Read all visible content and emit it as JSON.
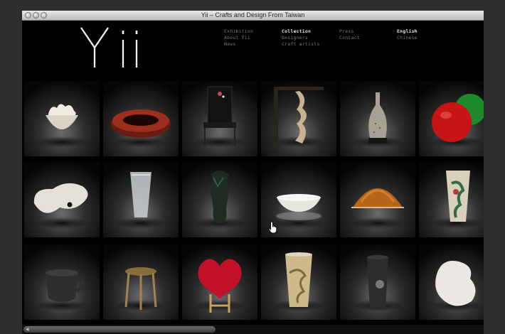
{
  "window": {
    "title": "Yii – Crafts and Design From Taiwan"
  },
  "logo": {
    "text": "Yii"
  },
  "nav": {
    "col1": [
      "Exhibition",
      "About Yii",
      "News"
    ],
    "col2": [
      "Collection",
      "Designers",
      "Craft artists"
    ],
    "col3": [
      "Press",
      "Contact"
    ],
    "col4": [
      "English",
      "Chinese"
    ],
    "active": [
      "Collection",
      "English"
    ]
  },
  "products": [
    {
      "name": "crumpled-white-bowl-thumb",
      "kind": "bowl-white"
    },
    {
      "name": "red-lacquer-ring-thumb",
      "kind": "ring-red"
    },
    {
      "name": "lacquer-chair-thumb",
      "kind": "chair-black"
    },
    {
      "name": "carved-wood-stand-thumb",
      "kind": "carving"
    },
    {
      "name": "speckled-vase-thumb",
      "kind": "vase-speckled"
    },
    {
      "name": "red-green-apples-thumb",
      "kind": "apples"
    },
    {
      "name": "white-bean-sofa-thumb",
      "kind": "bean-white"
    },
    {
      "name": "glass-cup-thumb",
      "kind": "glass"
    },
    {
      "name": "dark-sculpture-vase-thumb",
      "kind": "sculpture-dark"
    },
    {
      "name": "white-dish-thumb",
      "kind": "dish-white"
    },
    {
      "name": "amber-dome-lamp-thumb",
      "kind": "dome-amber"
    },
    {
      "name": "painted-cup-thumb",
      "kind": "cup-painted"
    },
    {
      "name": "dark-mug-thumb",
      "kind": "mug-dark"
    },
    {
      "name": "wood-stool-thumb",
      "kind": "stool"
    },
    {
      "name": "red-heart-chair-thumb",
      "kind": "heart-chair"
    },
    {
      "name": "dragon-cup-thumb",
      "kind": "cup-dragon"
    },
    {
      "name": "dark-tumbler-thumb",
      "kind": "tumbler-dark"
    },
    {
      "name": "white-pebble-thumb",
      "kind": "pebble-white"
    }
  ]
}
